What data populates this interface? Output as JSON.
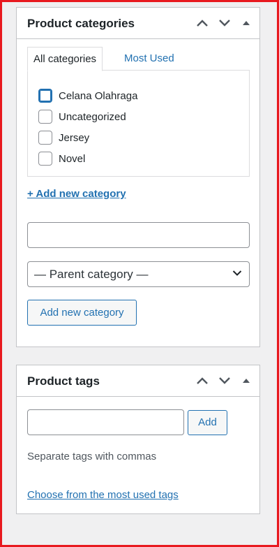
{
  "categories_box": {
    "title": "Product categories",
    "tabs": [
      {
        "label": "All categories",
        "active": true
      },
      {
        "label": "Most Used",
        "active": false
      }
    ],
    "items": [
      {
        "label": "Celana Olahraga",
        "checked": false
      },
      {
        "label": "Uncategorized",
        "checked": false
      },
      {
        "label": "Jersey",
        "checked": false
      },
      {
        "label": "Novel",
        "checked": false
      }
    ],
    "add_link": "+ Add new category",
    "new_category_value": "",
    "parent_select": "— Parent category —",
    "add_button": "Add new category"
  },
  "tags_box": {
    "title": "Product tags",
    "input_value": "",
    "add_button": "Add",
    "hint": "Separate tags with commas",
    "choose_link": "Choose from the most used tags"
  },
  "colors": {
    "accent": "#2271b1",
    "border": "#c3c4c7",
    "frame": "#e8191f"
  },
  "icons": [
    "chevron-up-icon",
    "chevron-down-icon",
    "caret-up-icon"
  ]
}
